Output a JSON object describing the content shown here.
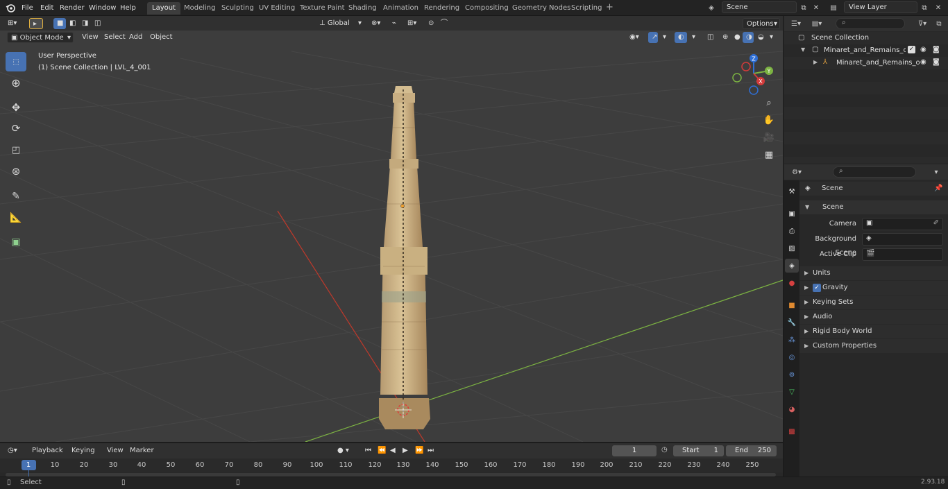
{
  "menu": [
    "File",
    "Edit",
    "Render",
    "Window",
    "Help"
  ],
  "workspaces": [
    "Layout",
    "Modeling",
    "Sculpting",
    "UV Editing",
    "Texture Paint",
    "Shading",
    "Animation",
    "Rendering",
    "Compositing",
    "Geometry Nodes",
    "Scripting"
  ],
  "active_workspace": "Layout",
  "scene_field": "Scene",
  "view_layer_field": "View Layer",
  "viewport": {
    "mode": "Object Mode",
    "menus": [
      "View",
      "Select",
      "Add",
      "Object"
    ],
    "orientation": "Global",
    "options": "Options",
    "overlay_title": "User Perspective",
    "overlay_subtitle": "(1) Scene Collection | LVL_4_001",
    "gizmo_x": "X",
    "gizmo_y": "Y",
    "gizmo_z": "Z"
  },
  "outliner": {
    "root": "Scene Collection",
    "items": [
      "Minaret_and_Remains_of_Jam",
      "Minaret_and_Remains_of"
    ]
  },
  "properties": {
    "context": "Scene",
    "panel": "Scene",
    "camera_label": "Camera",
    "background_label": "Background Scene",
    "clip_label": "Active Clip",
    "subpanels": [
      "Units",
      "Gravity",
      "Keying Sets",
      "Audio",
      "Rigid Body World",
      "Custom Properties"
    ]
  },
  "timeline": {
    "menus": [
      "Playback",
      "Keying",
      "View",
      "Marker"
    ],
    "current_frame": "1",
    "start_label": "Start",
    "start": "1",
    "end_label": "End",
    "end": "250",
    "ticks": [
      "1",
      "10",
      "20",
      "30",
      "40",
      "50",
      "60",
      "70",
      "80",
      "90",
      "100",
      "110",
      "120",
      "130",
      "140",
      "150",
      "160",
      "170",
      "180",
      "190",
      "200",
      "210",
      "220",
      "230",
      "240",
      "250"
    ]
  },
  "status": {
    "left": "Select",
    "version": "2.93.18"
  },
  "colors": {
    "accent": "#4772b3",
    "x_axis": "#c0392b",
    "y_axis": "#7cb342"
  }
}
